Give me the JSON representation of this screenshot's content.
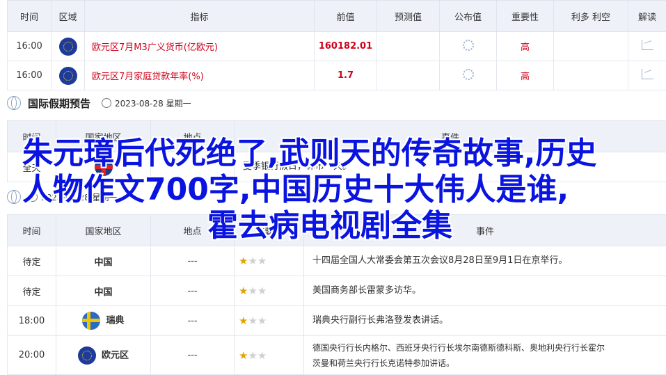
{
  "table1": {
    "headers": [
      "时间",
      "区域",
      "指标",
      "前值",
      "预测值",
      "公布值",
      "重要性",
      "利多 利空",
      "解读"
    ],
    "rows": [
      {
        "time": "16:00",
        "flag": "eu-flag-icon",
        "indicator": "欧元区7月M3广义货币(亿欧元)",
        "prev": "160182.01",
        "importance": "高"
      },
      {
        "time": "16:00",
        "flag": "eu-flag-icon",
        "indicator": "欧元区7月家庭贷款年率(%)",
        "prev": "1.7",
        "importance": "高"
      }
    ]
  },
  "holiday": {
    "title": "国际假期预告",
    "date": "2023-08-28 星期一",
    "headers": [
      "时间",
      "国家地区",
      "地点",
      "事件"
    ],
    "row": {
      "time": "全天",
      "event": "夏季银行假日，休市一天。"
    }
  },
  "events": {
    "date": "2023-08-28 星期一",
    "headers": [
      "时间",
      "国家地区",
      "地点",
      "重要性",
      "事件"
    ],
    "rows": [
      {
        "time": "待定",
        "region": "中国",
        "place": "---",
        "stars": 1,
        "event": "十四届全国人大常委会第五次会议8月28日至9月1日在京举行。"
      },
      {
        "time": "待定",
        "region": "中国",
        "place": "---",
        "stars": 1,
        "event": "美国商务部长雷蒙多访华。"
      },
      {
        "time": "18:00",
        "region": "瑞典",
        "place": "---",
        "stars": 1,
        "event": "瑞典央行副行长弗洛登发表讲话。"
      },
      {
        "time": "20:00",
        "region": "欧元区",
        "place": "---",
        "stars": 1,
        "event_line1": "德国央行行长内格尔、西班牙央行行长埃尔南德斯德科斯、奥地利央行行长霍尔",
        "event_line2": "茨曼和荷兰央行行长克诺特参加讲话。"
      }
    ]
  },
  "overlay": {
    "line1": "朱元璋后代死绝了,武则天的传奇故事,历史",
    "line2": "人物作文700字,中国历史十大伟人是谁,",
    "line3": "霍去病电视剧全集"
  }
}
